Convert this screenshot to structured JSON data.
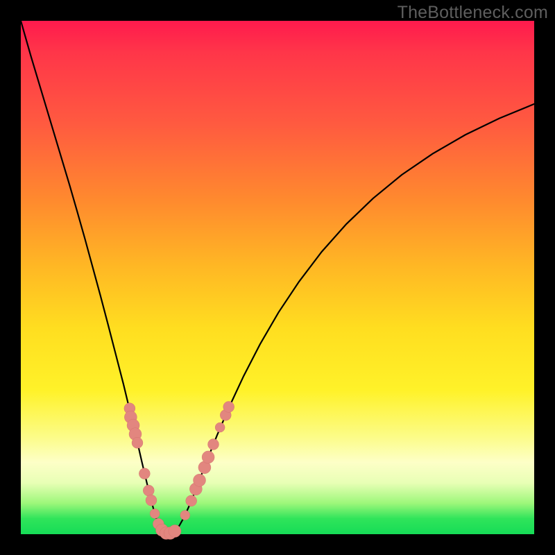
{
  "watermark": "TheBottleneck.com",
  "chart_data": {
    "type": "line",
    "title": "",
    "xlabel": "",
    "ylabel": "",
    "xlim": [
      0,
      1
    ],
    "ylim": [
      0,
      1
    ],
    "grid": false,
    "curve": [
      {
        "x": 0.0,
        "y": 1.0
      },
      {
        "x": 0.01,
        "y": 0.965
      },
      {
        "x": 0.02,
        "y": 0.93
      },
      {
        "x": 0.035,
        "y": 0.88
      },
      {
        "x": 0.05,
        "y": 0.83
      },
      {
        "x": 0.065,
        "y": 0.78
      },
      {
        "x": 0.08,
        "y": 0.73
      },
      {
        "x": 0.095,
        "y": 0.68
      },
      {
        "x": 0.11,
        "y": 0.628
      },
      {
        "x": 0.125,
        "y": 0.575
      },
      {
        "x": 0.14,
        "y": 0.52
      },
      {
        "x": 0.155,
        "y": 0.465
      },
      {
        "x": 0.17,
        "y": 0.408
      },
      {
        "x": 0.185,
        "y": 0.35
      },
      {
        "x": 0.2,
        "y": 0.292
      },
      {
        "x": 0.213,
        "y": 0.238
      },
      {
        "x": 0.225,
        "y": 0.188
      },
      {
        "x": 0.236,
        "y": 0.14
      },
      {
        "x": 0.246,
        "y": 0.098
      },
      {
        "x": 0.255,
        "y": 0.062
      },
      {
        "x": 0.262,
        "y": 0.036
      },
      {
        "x": 0.269,
        "y": 0.017
      },
      {
        "x": 0.276,
        "y": 0.006
      },
      {
        "x": 0.283,
        "y": 0.001
      },
      {
        "x": 0.292,
        "y": 0.001
      },
      {
        "x": 0.3,
        "y": 0.006
      },
      {
        "x": 0.309,
        "y": 0.017
      },
      {
        "x": 0.319,
        "y": 0.035
      },
      {
        "x": 0.331,
        "y": 0.062
      },
      {
        "x": 0.345,
        "y": 0.098
      },
      {
        "x": 0.362,
        "y": 0.142
      },
      {
        "x": 0.382,
        "y": 0.192
      },
      {
        "x": 0.406,
        "y": 0.248
      },
      {
        "x": 0.434,
        "y": 0.308
      },
      {
        "x": 0.466,
        "y": 0.37
      },
      {
        "x": 0.502,
        "y": 0.432
      },
      {
        "x": 0.542,
        "y": 0.492
      },
      {
        "x": 0.586,
        "y": 0.55
      },
      {
        "x": 0.634,
        "y": 0.604
      },
      {
        "x": 0.686,
        "y": 0.654
      },
      {
        "x": 0.742,
        "y": 0.7
      },
      {
        "x": 0.802,
        "y": 0.741
      },
      {
        "x": 0.866,
        "y": 0.778
      },
      {
        "x": 0.932,
        "y": 0.81
      },
      {
        "x": 1.0,
        "y": 0.838
      }
    ],
    "marker_color": "#e2867f",
    "markers": [
      {
        "x": 0.212,
        "y": 0.245,
        "r": 8
      },
      {
        "x": 0.214,
        "y": 0.228,
        "r": 9
      },
      {
        "x": 0.219,
        "y": 0.212,
        "r": 9
      },
      {
        "x": 0.223,
        "y": 0.195,
        "r": 9
      },
      {
        "x": 0.227,
        "y": 0.178,
        "r": 8
      },
      {
        "x": 0.241,
        "y": 0.118,
        "r": 8
      },
      {
        "x": 0.249,
        "y": 0.085,
        "r": 8
      },
      {
        "x": 0.254,
        "y": 0.066,
        "r": 8
      },
      {
        "x": 0.261,
        "y": 0.04,
        "r": 7
      },
      {
        "x": 0.268,
        "y": 0.02,
        "r": 8
      },
      {
        "x": 0.275,
        "y": 0.008,
        "r": 9
      },
      {
        "x": 0.283,
        "y": 0.002,
        "r": 9
      },
      {
        "x": 0.291,
        "y": 0.002,
        "r": 9
      },
      {
        "x": 0.3,
        "y": 0.006,
        "r": 9
      },
      {
        "x": 0.32,
        "y": 0.037,
        "r": 7
      },
      {
        "x": 0.332,
        "y": 0.065,
        "r": 8
      },
      {
        "x": 0.341,
        "y": 0.088,
        "r": 9
      },
      {
        "x": 0.348,
        "y": 0.105,
        "r": 9
      },
      {
        "x": 0.358,
        "y": 0.13,
        "r": 9
      },
      {
        "x": 0.365,
        "y": 0.15,
        "r": 9
      },
      {
        "x": 0.375,
        "y": 0.175,
        "r": 8
      },
      {
        "x": 0.388,
        "y": 0.208,
        "r": 7
      },
      {
        "x": 0.399,
        "y": 0.232,
        "r": 8
      },
      {
        "x": 0.405,
        "y": 0.248,
        "r": 8
      }
    ]
  }
}
